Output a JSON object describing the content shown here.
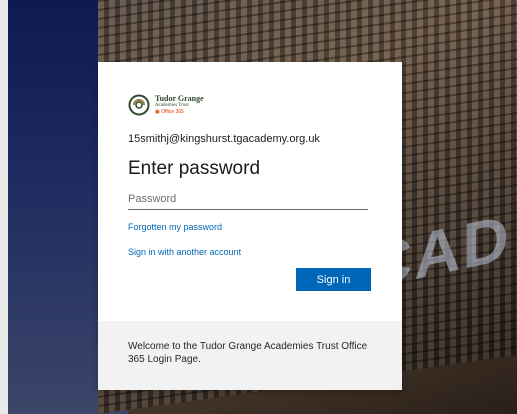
{
  "background": {
    "lettering": "CAD"
  },
  "logo": {
    "name": "Tudor Grange",
    "subtitle": "Academies Trust",
    "product": "Office 365",
    "accent_color": "#2e4a2c",
    "office_color": "#d83b01"
  },
  "account": {
    "email": "15smithj@kingshurst.tgacademy.org.uk"
  },
  "form": {
    "title": "Enter password",
    "password_placeholder": "Password",
    "password_value": "",
    "forgot_link": "Forgotten my password",
    "another_account_link": "Sign in with another account",
    "signin_label": "Sign in",
    "button_color": "#0067b8",
    "link_color": "#0067b8"
  },
  "footer": {
    "message": "Welcome to the Tudor Grange Academies Trust Office 365 Login Page."
  }
}
